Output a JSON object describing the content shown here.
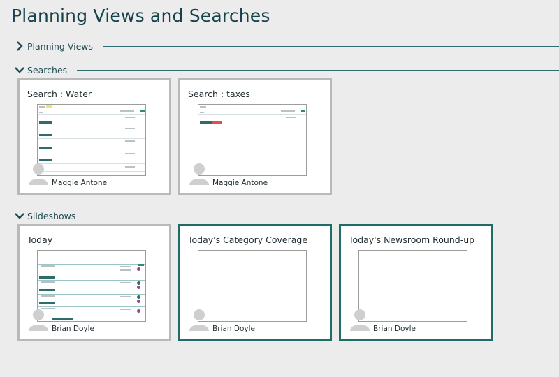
{
  "page": {
    "title": "Planning Views and Searches"
  },
  "sections": {
    "planning_views": {
      "label": "Planning Views",
      "expanded": false,
      "icon": "chevron-right-icon"
    },
    "searches": {
      "label": "Searches",
      "expanded": true,
      "icon": "chevron-down-icon"
    },
    "slideshows": {
      "label": "Slideshows",
      "expanded": true,
      "icon": "chevron-down-icon"
    }
  },
  "searches": [
    {
      "title": "Search : Water",
      "owner": "Maggie Antone"
    },
    {
      "title": "Search : taxes",
      "owner": "Maggie Antone"
    }
  ],
  "slideshows": [
    {
      "title": "Today",
      "owner": "Brian Doyle"
    },
    {
      "title": "Today's Category Coverage",
      "owner": "Brian Doyle"
    },
    {
      "title": "Today's Newsroom Round-up",
      "owner": "Brian Doyle"
    }
  ],
  "colors": {
    "accent": "#1f6b67",
    "card_border_default": "#b9b9b9",
    "background": "#ececec"
  }
}
